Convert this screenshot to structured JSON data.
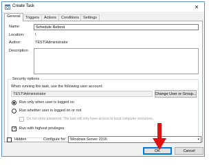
{
  "window": {
    "title": "Create Task"
  },
  "tabs": [
    {
      "label": "General"
    },
    {
      "label": "Triggers"
    },
    {
      "label": "Actions"
    },
    {
      "label": "Conditions"
    },
    {
      "label": "Settings"
    }
  ],
  "general": {
    "name_label": "Name:",
    "name_value": "Schedule Reboot",
    "location_label": "Location:",
    "location_value": "\\",
    "author_label": "Author:",
    "author_value": "TEST\\Administrator",
    "description_label": "Description:"
  },
  "security": {
    "title": "Security options",
    "account_prompt": "When running the task, use the following user account:",
    "account_value": "TEST\\Administrator",
    "change_button": "Change User or Group...",
    "radio_logged_on": "Run only when user is logged on",
    "radio_any": "Run whether user is logged on or not",
    "no_password": "Do not store password.  The task will only have access to local computer resources.",
    "highest_privileges": "Run with highest privileges"
  },
  "footer": {
    "hidden_label": "Hidden",
    "configure_label": "Configure for:",
    "configure_value": "Windows Server 2016",
    "ok_button": "OK",
    "cancel_button": "Cancel"
  },
  "states": {
    "radio_logged_on_selected": true,
    "highest_privileges_checked": true,
    "hidden_checked": false
  },
  "colors": {
    "annotation_arrow": "#e01010",
    "accent": "#0078d7"
  }
}
